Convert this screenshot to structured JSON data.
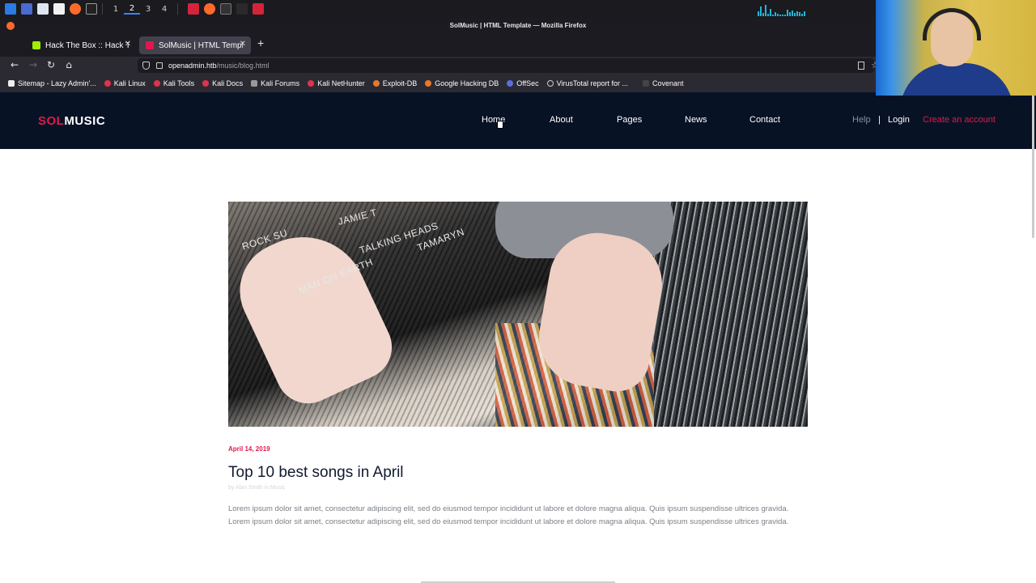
{
  "os_panel": {
    "workspaces": [
      "1",
      "2",
      "3",
      "4"
    ],
    "active_workspace": "2"
  },
  "window": {
    "title": "SolMusic | HTML Template — Mozilla Firefox"
  },
  "tabs": [
    {
      "label": "Hack The Box :: Hack The",
      "active": false
    },
    {
      "label": "SolMusic | HTML Templat",
      "active": true
    }
  ],
  "new_tab_label": "+",
  "url": {
    "host": "openadmin.htb",
    "path": "/music/blog.html"
  },
  "bookmarks": [
    "Sitemap - Lazy Admin'...",
    "Kali Linux",
    "Kali Tools",
    "Kali Docs",
    "Kali Forums",
    "Kali NetHunter",
    "Exploit-DB",
    "Google Hacking DB",
    "OffSec",
    "VirusTotal report for ...",
    "Covenant"
  ],
  "site": {
    "logo_sol": "SOL",
    "logo_music": "MUSIC",
    "menu": [
      "Home",
      "About",
      "Pages",
      "News",
      "Contact"
    ],
    "help": "Help",
    "separator": "|",
    "login": "Login",
    "create_account": "Create an account"
  },
  "hero_labels": {
    "label1": "JAMIE T",
    "label2": "TALKING HEADS",
    "label3": "TAMARYN",
    "label4": "ROCK SU",
    "label5": "MAN ON EARTH"
  },
  "post": {
    "date": "April 14, 2019",
    "title": "Top 10 best songs in April",
    "meta": "by Alan Smith in Music",
    "body": "Lorem ipsum dolor sit amet, consectetur adipiscing elit, sed do eiusmod tempor incididunt ut labore et dolore magna aliqua. Quis ipsum suspendisse ultrices gravida. Lorem ipsum dolor sit amet, consectetur adipiscing elit, sed do eiusmod tempor incididunt ut labore et dolore magna aliqua. Quis ipsum suspendisse ultrices gravida."
  },
  "colors": {
    "accent": "#e1194b",
    "header_bg": "#081225"
  }
}
